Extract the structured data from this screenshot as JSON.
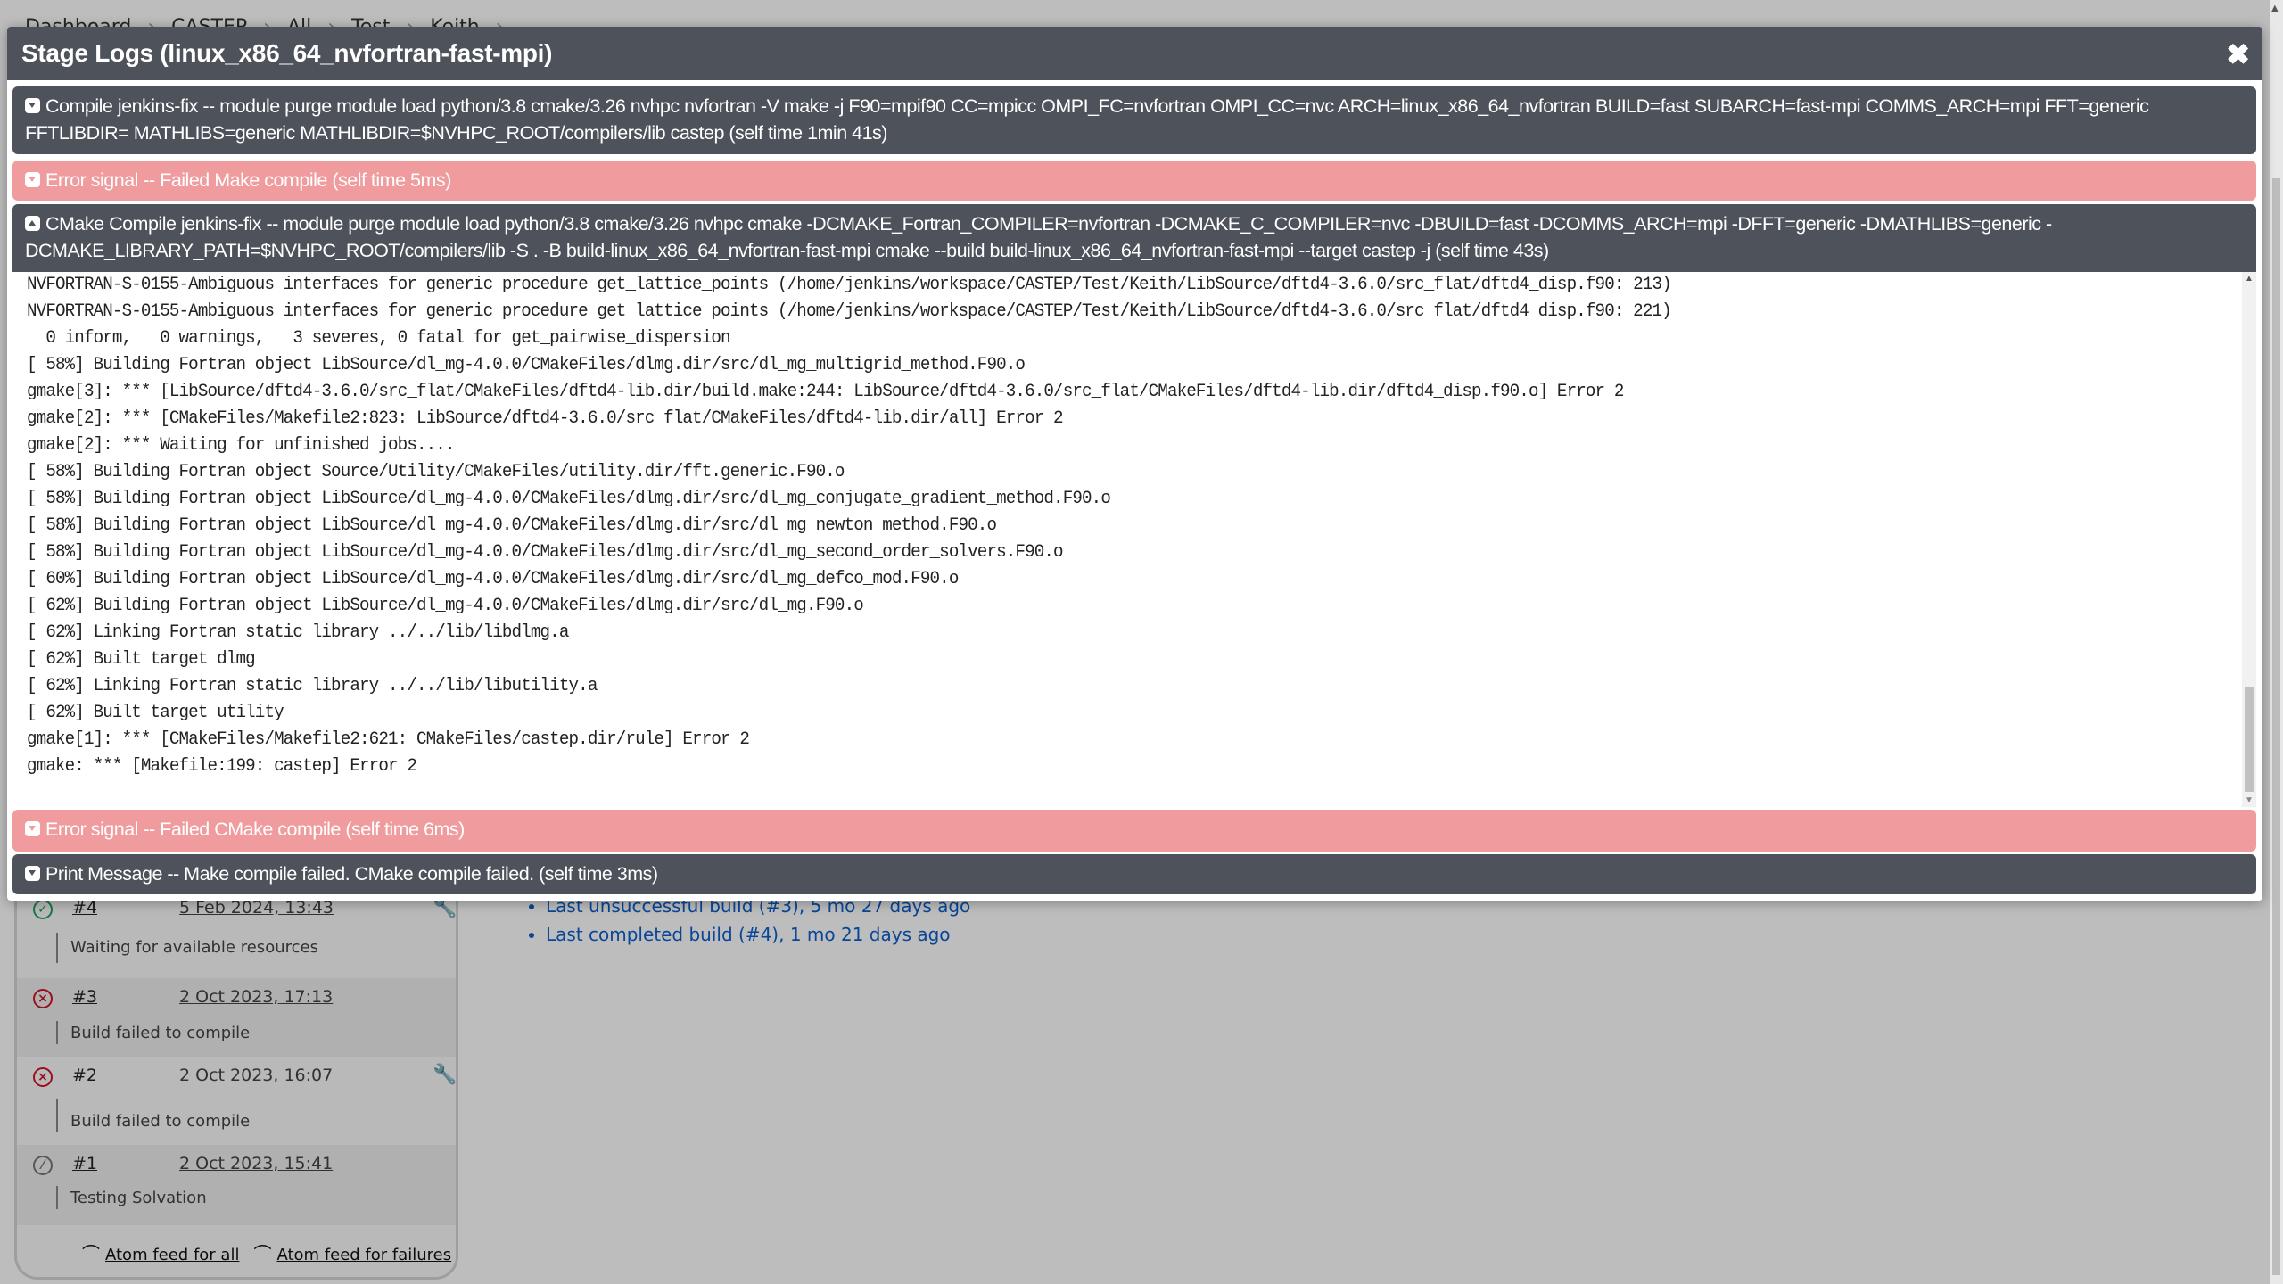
{
  "breadcrumb": [
    "Dashboard",
    "CASTEP",
    "All",
    "Test",
    "Keith"
  ],
  "modal": {
    "title": "Stage Logs (linux_x86_64_nvfortran-fast-mpi)",
    "close_icon": "close-icon",
    "stages": [
      {
        "label": "Compile jenkins-fix -- module purge module load python/3.8 cmake/3.26 nvhpc nvfortran -V make -j F90=mpif90 CC=mpicc OMPI_FC=nvfortran OMPI_CC=nvc ARCH=linux_x86_64_nvfortran BUILD=fast SUBARCH=fast-mpi COMMS_ARCH=mpi FFT=generic FFTLIBDIR= MATHLIBS=generic MATHLIBDIR=$NVHPC_ROOT/compilers/lib castep (self time 1min 41s)",
        "state": "collapsed",
        "status": "normal"
      },
      {
        "label": "Error signal -- Failed Make compile (self time 5ms)",
        "state": "collapsed",
        "status": "error"
      },
      {
        "label": "CMake Compile jenkins-fix -- module purge module load python/3.8 cmake/3.26 nvhpc cmake -DCMAKE_Fortran_COMPILER=nvfortran -DCMAKE_C_COMPILER=nvc -DBUILD=fast -DCOMMS_ARCH=mpi -DFFT=generic -DMATHLIBS=generic -DCMAKE_LIBRARY_PATH=$NVHPC_ROOT/compilers/lib -S . -B build-linux_x86_64_nvfortran-fast-mpi cmake --build build-linux_x86_64_nvfortran-fast-mpi --target castep -j (self time 43s)",
        "state": "expanded",
        "status": "normal"
      },
      {
        "label": "Error signal -- Failed CMake compile (self time 6ms)",
        "state": "collapsed",
        "status": "error"
      },
      {
        "label": "Print Message -- Make compile failed. CMake compile failed. (self time 3ms)",
        "state": "collapsed",
        "status": "normal"
      }
    ],
    "log_lines": [
      "NVFORTRAN-S-0155-Ambiguous interfaces for generic procedure get_lattice_points (/home/jenkins/workspace/CASTEP/Test/Keith/LibSource/dftd4-3.6.0/src_flat/dftd4_disp.f90: 213)",
      "NVFORTRAN-S-0155-Ambiguous interfaces for generic procedure get_lattice_points (/home/jenkins/workspace/CASTEP/Test/Keith/LibSource/dftd4-3.6.0/src_flat/dftd4_disp.f90: 221)",
      "  0 inform,   0 warnings,   3 severes, 0 fatal for get_pairwise_dispersion",
      "[ 58%] Building Fortran object LibSource/dl_mg-4.0.0/CMakeFiles/dlmg.dir/src/dl_mg_multigrid_method.F90.o",
      "gmake[3]: *** [LibSource/dftd4-3.6.0/src_flat/CMakeFiles/dftd4-lib.dir/build.make:244: LibSource/dftd4-3.6.0/src_flat/CMakeFiles/dftd4-lib.dir/dftd4_disp.f90.o] Error 2",
      "gmake[2]: *** [CMakeFiles/Makefile2:823: LibSource/dftd4-3.6.0/src_flat/CMakeFiles/dftd4-lib.dir/all] Error 2",
      "gmake[2]: *** Waiting for unfinished jobs....",
      "[ 58%] Building Fortran object Source/Utility/CMakeFiles/utility.dir/fft.generic.F90.o",
      "[ 58%] Building Fortran object LibSource/dl_mg-4.0.0/CMakeFiles/dlmg.dir/src/dl_mg_conjugate_gradient_method.F90.o",
      "[ 58%] Building Fortran object LibSource/dl_mg-4.0.0/CMakeFiles/dlmg.dir/src/dl_mg_newton_method.F90.o",
      "[ 58%] Building Fortran object LibSource/dl_mg-4.0.0/CMakeFiles/dlmg.dir/src/dl_mg_second_order_solvers.F90.o",
      "[ 60%] Building Fortran object LibSource/dl_mg-4.0.0/CMakeFiles/dlmg.dir/src/dl_mg_defco_mod.F90.o",
      "[ 62%] Building Fortran object LibSource/dl_mg-4.0.0/CMakeFiles/dlmg.dir/src/dl_mg.F90.o",
      "[ 62%] Linking Fortran static library ../../lib/libdlmg.a",
      "[ 62%] Built target dlmg",
      "[ 62%] Linking Fortran static library ../../lib/libutility.a",
      "[ 62%] Built target utility",
      "gmake[1]: *** [CMakeFiles/Makefile2:621: CMakeFiles/castep.dir/rule] Error 2",
      "gmake: *** [Makefile:199: castep] Error 2"
    ]
  },
  "build_history": {
    "builds": [
      {
        "number": "#4",
        "date": "5 Feb 2024, 13:43",
        "status": "success",
        "description": "Waiting for available resources",
        "has_tool_icon": true
      },
      {
        "number": "#3",
        "date": "2 Oct 2023, 17:13",
        "status": "failed",
        "description": "Build failed to compile",
        "has_tool_icon": false
      },
      {
        "number": "#2",
        "date": "2 Oct 2023, 16:07",
        "status": "failed",
        "description": "Build failed to compile",
        "has_tool_icon": true
      },
      {
        "number": "#1",
        "date": "2 Oct 2023, 15:41",
        "status": "aborted",
        "description": "Testing Solvation",
        "has_tool_icon": false
      }
    ],
    "feeds": {
      "all": "Atom feed for all",
      "failures": "Atom feed for failures"
    }
  },
  "permalinks": [
    "Last unsuccessful build (#3), 5 mo 27 days ago",
    "Last completed build (#4), 1 mo 21 days ago"
  ],
  "colors": {
    "header_bg": "#4d525b",
    "error_bg": "#f09c9e",
    "success": "#1ea362",
    "failure": "#d2142c",
    "link": "#0b5fcc"
  }
}
